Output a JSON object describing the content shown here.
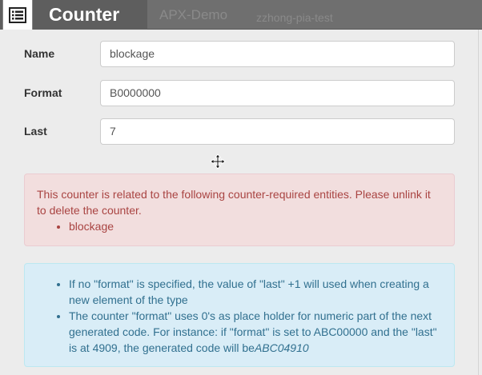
{
  "background_app": {
    "item1": "APX-Demo",
    "item2": "zzhong-pia-test"
  },
  "dialog": {
    "title": "Counter",
    "icon": "list-icon"
  },
  "form": {
    "name": {
      "label": "Name",
      "value": "blockage"
    },
    "format": {
      "label": "Format",
      "value": "B0000000"
    },
    "last": {
      "label": "Last",
      "value": "7"
    }
  },
  "danger_alert": {
    "message": "This counter is related to the following counter-required entities. Please unlink it to delete the counter.",
    "items": [
      "blockage"
    ]
  },
  "info_alert": {
    "item1": "If no \"format\" is specified, the value of \"last\" +1 will used when creating a new element of the type",
    "item2_text": "The counter \"format\" uses 0's as place holder for numeric part of the next generated code. For instance: if \"format\" is set to ABC00000 and the \"last\" is at 4909, the generated code will be",
    "item2_example": "ABC04910"
  },
  "colors": {
    "danger_text": "#a94442",
    "danger_bg": "#f2dede",
    "info_text": "#31708f",
    "info_bg": "#d9edf7"
  }
}
